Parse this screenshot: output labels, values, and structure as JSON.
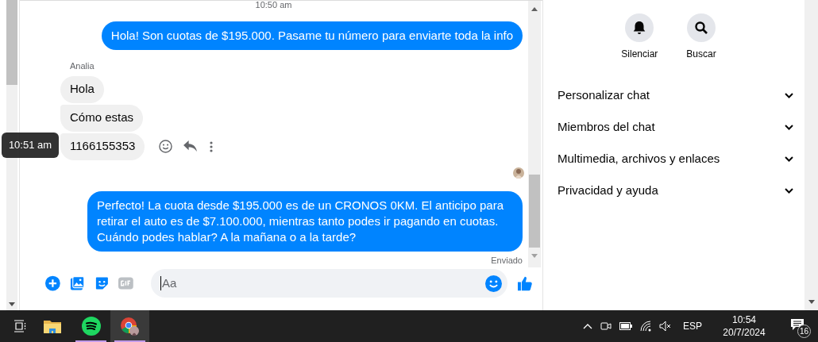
{
  "chat": {
    "timestamp": "10:50 am",
    "messages": [
      {
        "kind": "outgoing",
        "text": "Hola! Son cuotas de $195.000. Pasame tu número para enviarte toda la info"
      },
      {
        "kind": "sender",
        "text": "Analia"
      },
      {
        "kind": "incoming",
        "text": "Hola"
      },
      {
        "kind": "incoming",
        "text": "Cómo estas"
      },
      {
        "kind": "incoming",
        "text": "1166155353",
        "hovered": true
      },
      {
        "kind": "seen"
      },
      {
        "kind": "outgoing",
        "text": "Perfecto! La cuota desde $195.000 es de un CRONOS 0KM. El anticipo para retirar el auto es de $7.100.000, mientras tanto podes ir pagando en cuotas. Cuándo podes hablar? A la mañana o a la tarde?"
      }
    ],
    "hover_time": "10:51 am",
    "status": "Enviado",
    "composer": {
      "placeholder": "Aa"
    }
  },
  "sidebar": {
    "actions": [
      {
        "kind": "bell",
        "label": "Silenciar"
      },
      {
        "kind": "search",
        "label": "Buscar"
      }
    ],
    "sections": [
      {
        "label": "Personalizar chat",
        "expanded": false
      },
      {
        "label": "Miembros del chat",
        "expanded": false
      },
      {
        "label": "Multimedia, archivos y enlaces",
        "expanded": false
      },
      {
        "label": "Privacidad y ayuda",
        "expanded": false
      }
    ]
  },
  "taskbar": {
    "apps": [
      {
        "kind": "folder",
        "running": false,
        "selected": false
      },
      {
        "kind": "music",
        "running": true,
        "selected": false
      },
      {
        "kind": "browser",
        "running": true,
        "selected": true
      }
    ],
    "language": "ESP",
    "time": "10:54",
    "date": "20/7/2024",
    "notification_count": "16"
  }
}
